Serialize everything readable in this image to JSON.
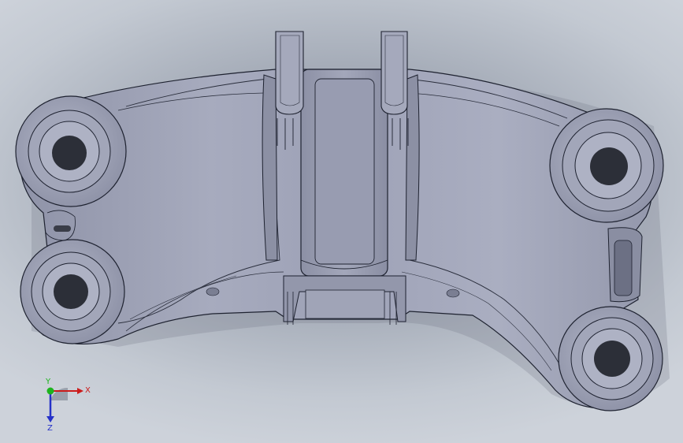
{
  "viewport": {
    "model_name": "",
    "background_top": "#8f96a3",
    "background_bottom": "#cdd2da"
  },
  "part": {
    "body_color": "#9ea2b6",
    "edge_color": "#1e2230",
    "hole_color": "#2c2f38"
  },
  "triad": {
    "x_label": "X",
    "y_label": "Y",
    "z_label": "Z",
    "x_color": "#cc1b1b",
    "y_color": "#1db41d",
    "z_color": "#2531c8"
  }
}
